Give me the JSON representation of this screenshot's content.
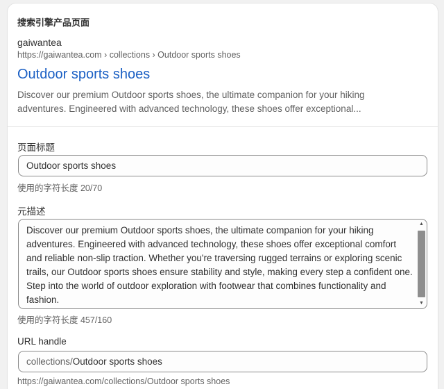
{
  "seo": {
    "section_title": "搜索引擎产品页面",
    "preview": {
      "site_name": "gaiwantea",
      "url": "https://gaiwantea.com › collections › Outdoor sports shoes",
      "title": "Outdoor sports shoes",
      "description": "Discover our premium Outdoor sports shoes, the ultimate companion for your hiking adventures. Engineered with advanced technology, these shoes offer exceptional..."
    },
    "page_title": {
      "label": "页面标题",
      "value": "Outdoor sports shoes",
      "help": "使用的字符长度 20/70"
    },
    "meta_description": {
      "label": "元描述",
      "value": "Discover our premium Outdoor sports shoes, the ultimate companion for your hiking adventures. Engineered with advanced technology, these shoes offer exceptional comfort and reliable non-slip traction. Whether you're traversing rugged terrains or exploring scenic trails, our Outdoor sports shoes ensure stability and style, making every step a confident one. Step into the world of outdoor exploration with footwear that combines functionality and fashion.",
      "help": "使用的字符长度 457/160"
    },
    "url_handle": {
      "label": "URL handle",
      "prefix": "collections/",
      "value": "Outdoor sports shoes",
      "help": "https://gaiwantea.com/collections/Outdoor sports shoes"
    }
  },
  "icons": {
    "scroll_up": "▲",
    "scroll_down": "▼"
  },
  "colors": {
    "link_title": "#1a5fc4",
    "muted_text": "#616161",
    "border": "#8a8a8a"
  }
}
